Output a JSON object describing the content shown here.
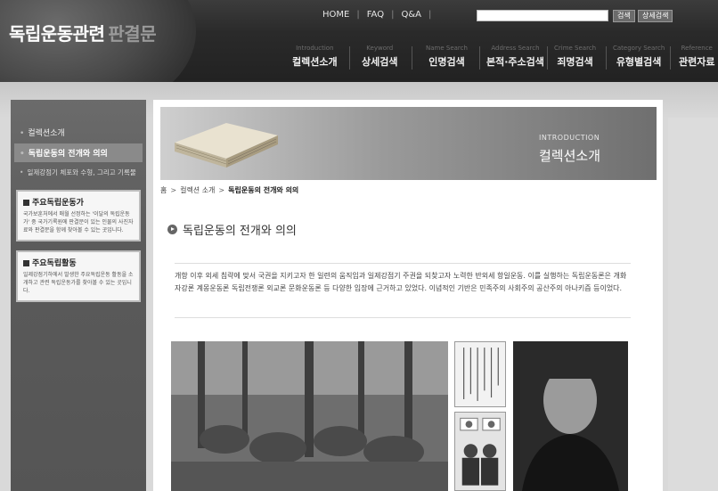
{
  "logo": {
    "main": "독립운동관련",
    "sub": "판결문"
  },
  "topnav": [
    {
      "label": "HOME"
    },
    {
      "label": "FAQ"
    },
    {
      "label": "Q&A"
    }
  ],
  "search": {
    "placeholder": "",
    "search_button": "검색",
    "advanced_button": "상세검색"
  },
  "gnb": [
    {
      "en": "Introduction",
      "ko": "컬렉션소개"
    },
    {
      "en": "Keyword",
      "ko": "상세검색"
    },
    {
      "en": "Name Search",
      "ko": "인명검색"
    },
    {
      "en": "Address Search",
      "ko": "본적·주소검색"
    },
    {
      "en": "Crime Search",
      "ko": "죄명검색"
    },
    {
      "en": "Category Search",
      "ko": "유형별검색"
    },
    {
      "en": "Reference",
      "ko": "관련자료"
    }
  ],
  "sidebar": {
    "items": [
      {
        "label": "컬렉션소개"
      },
      {
        "label": "독립운동의 전개와 의의"
      },
      {
        "label": "일제강점기 체포와 수형, 그리고 기록물"
      }
    ],
    "boxes": [
      {
        "title": "주요독립운동가",
        "desc": "국가보훈처에서 매월 선정하는 '이달의 독립운동가' 중 국가기록원에 판결문이 있는 인물의 사진자료와 판결문을 함께 찾아볼 수 있는 곳입니다."
      },
      {
        "title": "주요독립활동",
        "desc": "일제강점기하에서 발생한 주요독립운동 활동을 소개하고 관련 독립운동가를 찾아볼 수 있는 곳입니다."
      }
    ]
  },
  "banner": {
    "en": "INTRODUCTION",
    "ko": "컬렉션소개"
  },
  "breadcrumb": {
    "home": "홈",
    "parent": "컬렉션 소개",
    "current": "독립운동의 전개와 의의"
  },
  "page": {
    "title": "독립운동의 전개와 의의",
    "intro": "개항 이후 외세 침략에 맞서 국권을 지키고자 한 일련의 움직임과 일제강점기 주권을 되찾고자 노력한 반외세 항일운동. 이를 실행하는 독립운동론은 개화자강론 계몽운동론 독립전쟁론 외교론 문화운동론 등 다양한 입장에 근거하고 있었다. 이념적인 기반은 민족주의 사회주의 공산주의 아나키즘 등이었다."
  },
  "colors": {
    "header": "#2a2a2a",
    "sidebar": "#5f5f5f",
    "active_item": "#8a8a8a",
    "panel": "#ffffff"
  }
}
